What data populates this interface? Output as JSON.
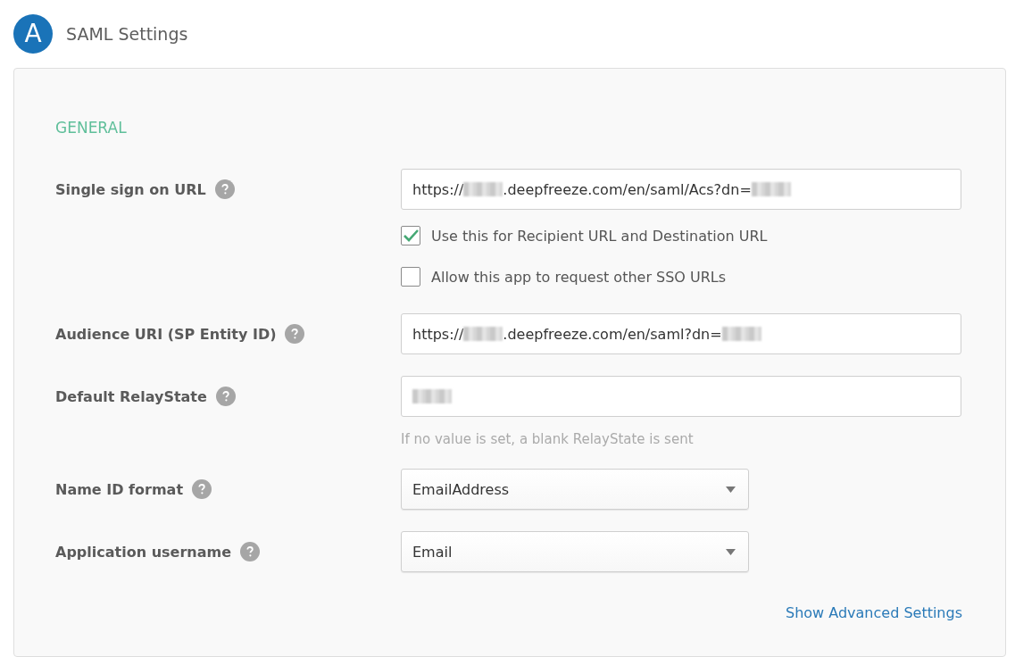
{
  "header": {
    "avatar_letter": "A",
    "title": "SAML Settings"
  },
  "section": {
    "heading": "GENERAL"
  },
  "fields": [
    {
      "label": "Single sign on URL",
      "kind": "text",
      "value": [
        {
          "kind": "text",
          "text": "https://"
        },
        {
          "kind": "redacted"
        },
        {
          "kind": "text",
          "text": ".deepfreeze.com/en/saml/Acs?dn="
        },
        {
          "kind": "redacted"
        }
      ],
      "options": [
        {
          "label": "Use this for Recipient URL and Destination URL",
          "checked": true
        },
        {
          "label": "Allow this app to request other SSO URLs",
          "checked": false
        }
      ]
    },
    {
      "label": "Audience URI (SP Entity ID)",
      "kind": "text",
      "value": [
        {
          "kind": "text",
          "text": "https://"
        },
        {
          "kind": "redacted"
        },
        {
          "kind": "text",
          "text": ".deepfreeze.com/en/saml?dn="
        },
        {
          "kind": "redacted"
        }
      ]
    },
    {
      "label": "Default RelayState",
      "kind": "text",
      "value": [
        {
          "kind": "redacted"
        }
      ],
      "hint": "If no value is set, a blank RelayState is sent"
    },
    {
      "label": "Name ID format",
      "kind": "select",
      "value": [
        {
          "kind": "text",
          "text": "EmailAddress"
        }
      ]
    },
    {
      "label": "Application username",
      "kind": "select",
      "value": [
        {
          "kind": "text",
          "text": "Email"
        }
      ]
    }
  ],
  "advanced_link": "Show Advanced Settings"
}
